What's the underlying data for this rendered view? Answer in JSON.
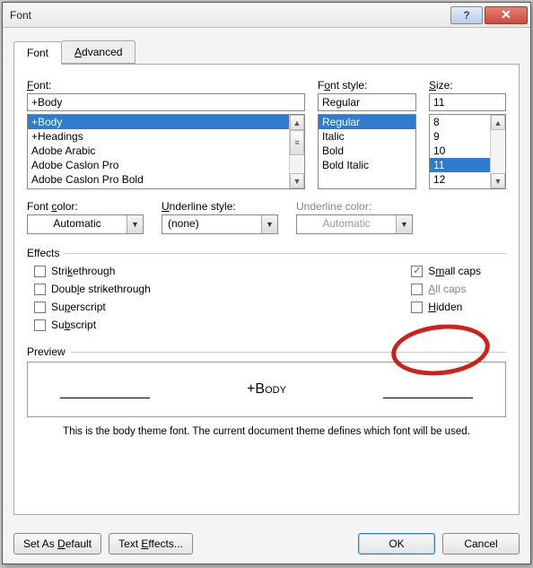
{
  "window": {
    "title": "Font"
  },
  "tabs": {
    "font": "Font",
    "advanced": "Advanced"
  },
  "labels": {
    "font": "Font:",
    "font_style": "Font style:",
    "size": "Size:",
    "font_color": "Font color:",
    "underline_style": "Underline style:",
    "underline_color": "Underline color:",
    "effects": "Effects",
    "preview": "Preview"
  },
  "inputs": {
    "font_value": "+Body",
    "style_value": "Regular",
    "size_value": "11"
  },
  "font_list": [
    "+Body",
    "+Headings",
    "Adobe Arabic",
    "Adobe Caslon Pro",
    "Adobe Caslon Pro Bold"
  ],
  "style_list": [
    "Regular",
    "Italic",
    "Bold",
    "Bold Italic"
  ],
  "size_list": [
    "8",
    "9",
    "10",
    "11",
    "12"
  ],
  "combos": {
    "font_color": "Automatic",
    "underline_style": "(none)",
    "underline_color": "Automatic"
  },
  "effects_labels": {
    "strike": "Strikethrough",
    "dstrike": "Double strikethrough",
    "superscript": "Superscript",
    "subscript": "Subscript",
    "smallcaps": "Small caps",
    "allcaps": "All caps",
    "hidden": "Hidden"
  },
  "effects_state": {
    "strike": false,
    "dstrike": false,
    "superscript": false,
    "subscript": false,
    "smallcaps": true,
    "allcaps": false,
    "hidden": false
  },
  "preview": {
    "text": "+Body",
    "description": "This is the body theme font. The current document theme defines which font will be used."
  },
  "buttons": {
    "set_default": "Set As Default",
    "text_effects": "Text Effects...",
    "ok": "OK",
    "cancel": "Cancel"
  },
  "colors": {
    "selection": "#2d7cd1",
    "highlight_ring": "#d1201a"
  }
}
